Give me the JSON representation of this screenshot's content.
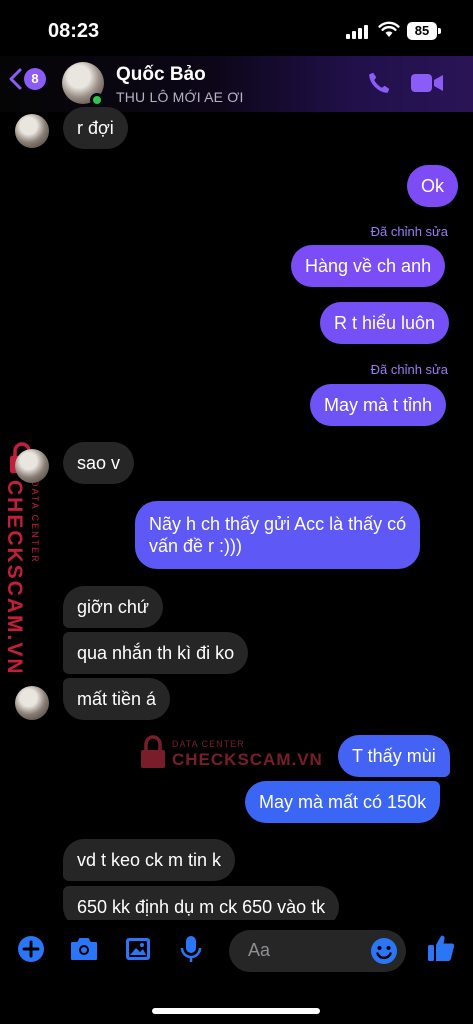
{
  "status_bar": {
    "time": "08:23",
    "battery": "85"
  },
  "header": {
    "unread_count": "8",
    "contact_name": "Quốc Bảo",
    "contact_status": "THU LÔ MỚI AE ƠI"
  },
  "messages": [
    {
      "text": "r đợi"
    },
    {
      "text": "Ok"
    },
    {
      "text": "Hàng về ch anh",
      "edited": "Đã chỉnh sửa"
    },
    {
      "text": "R t hiểu luôn"
    },
    {
      "text": "May mà t tỉnh",
      "edited": "Đã chỉnh sửa"
    },
    {
      "text": "sao v"
    },
    {
      "line1": "Nãy h ch thấy gửi Acc là thấy có",
      "line2": "vấn đề r :)))"
    },
    {
      "text": "giỡn chứ"
    },
    {
      "text": "qua nhắn th kì đi ko"
    },
    {
      "text": "mất tiền á"
    },
    {
      "text": "T thấy mùi"
    },
    {
      "text": "May mà mất có 150k"
    },
    {
      "text": "vd t keo ck m tin k"
    },
    {
      "text": "650 kk định dụ m ck 650 vào tk"
    }
  ],
  "watermark": {
    "brand": "CHECKSCAM.VN",
    "tagline": "DATA CENTER"
  },
  "composer": {
    "placeholder": "Aa"
  },
  "colors": {
    "accent": "#8b5cf6",
    "bubble_out_top": "#7d4cf5",
    "bubble_out_bottom": "#3a5ff5",
    "bubble_in": "#262626"
  }
}
